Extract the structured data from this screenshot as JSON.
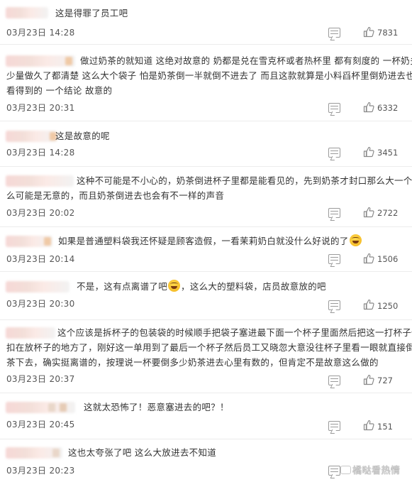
{
  "comments": [
    {
      "text": "这是得罪了员工吧",
      "time": "03月23日 14:28",
      "likes": "7831"
    },
    {
      "text_lines": [
        "做过奶茶的就知道 这绝对故意的 奶都是兑在雪克杯或者热杯里 都有刻度的 一杯奶多",
        "少量做久了都清楚 这么大个袋子 怕是奶茶倒一半就倒不进去了 而且这款就算是小料舀杯里倒奶进去也是",
        "看得到的 一个结论 故意的"
      ],
      "time": "03月23日 20:31",
      "likes": "6332"
    },
    {
      "text": "这是故意的呢",
      "time": "03月23日 14:28",
      "likes": "3451"
    },
    {
      "text_lines": [
        "这种不可能是不小心的，奶茶倒进杯子里都是能看见的，先到奶茶才封口那么大一个怎",
        "么可能是无意的，而且奶茶倒进去也会有不一样的声音"
      ],
      "time": "03月23日 20:02",
      "likes": "2722"
    },
    {
      "text": "如果是普通塑料袋我还怀疑是顾客造假，一看茉莉奶白就没什么好说的了",
      "time": "03月23日 20:14",
      "likes": "1506"
    },
    {
      "text_a": "不是，这有点离谱了吧",
      "text_b": "，这么大的塑料袋，店员故意放的吧",
      "time": "03月23日 20:30",
      "likes": "1250"
    },
    {
      "text_lines": [
        "这个应该是拆杯子的包装袋的时候顺手把袋子塞进最下面一个杯子里面然后把这一打杯子倒",
        "扣在放杯子的地方了，刚好这一单用到了最后一个杯子然后员工又晓忽大意没往杯子里看一眼就直接倒奶",
        "茶下去，确实挺离谱的，按理说一杯要倒多少奶茶进去心里有数的，但肯定不是故意这么做的"
      ],
      "time": "03月23日 20:37",
      "likes": "727"
    },
    {
      "text": "这就太恐怖了！恶意塞进去的吧？！",
      "time": "03月23日 20:45",
      "likes": "151"
    },
    {
      "text": "这也太夸张了吧 这么大放进去不知道",
      "time": "03月23日 20:23",
      "likes": ""
    }
  ],
  "watermark": "橘哒看热情",
  "icons": {
    "reply": "comment-reply-icon",
    "like": "thumbs-up-icon",
    "emoji": "laughing-emoji-icon"
  }
}
